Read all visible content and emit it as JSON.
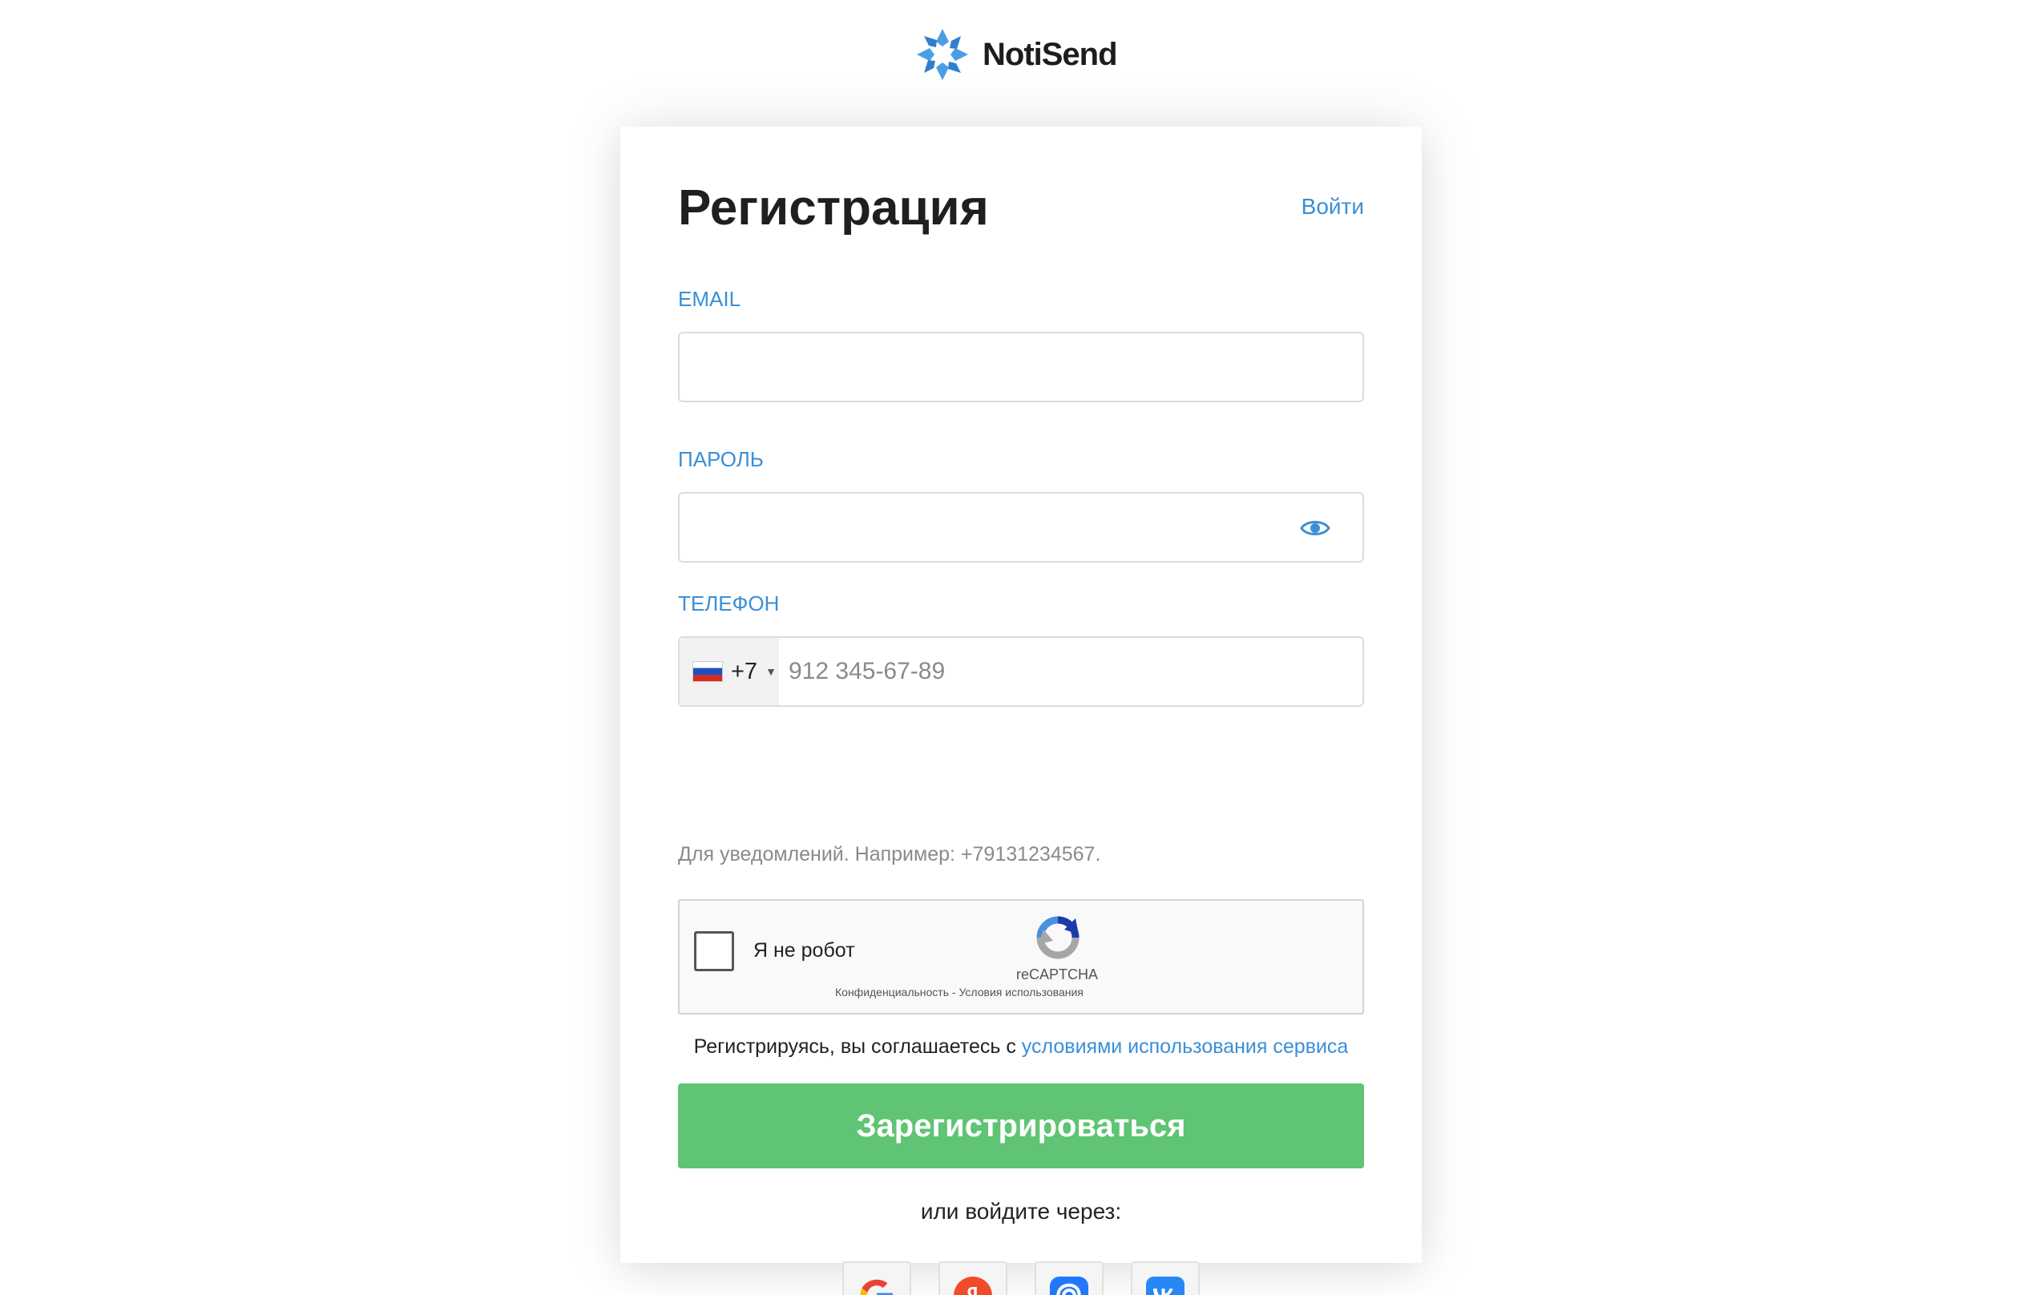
{
  "brand": {
    "name": "NotiSend",
    "color": "#3a8fd8"
  },
  "form": {
    "title": "Регистрация",
    "login_link": "Войти",
    "email": {
      "label": "EMAIL",
      "value": ""
    },
    "password": {
      "label": "ПАРОЛЬ",
      "value": ""
    },
    "phone": {
      "label": "ТЕЛЕФОН",
      "country_code": "+7",
      "placeholder": "912 345-67-89",
      "value": "",
      "hint": "Для уведомлений. Например: +79131234567."
    },
    "captcha": {
      "label": "Я не робот",
      "brand": "reCAPTCHA",
      "privacy": "Конфиденциальность",
      "separator": "-",
      "terms": "Условия использования"
    },
    "agreement": {
      "text": "Регистрируясь, вы соглашаетесь с",
      "link": "условиями использования сервиса"
    },
    "submit_label": "Зарегистрироваться",
    "or_text": "или войдите через:",
    "social_buttons": [
      "google-icon",
      "yandex-icon",
      "mailru-icon",
      "vk-icon"
    ]
  },
  "colors": {
    "accent": "#3a8fd8",
    "submit": "#5fc474",
    "hint": "#8a8a8a"
  }
}
